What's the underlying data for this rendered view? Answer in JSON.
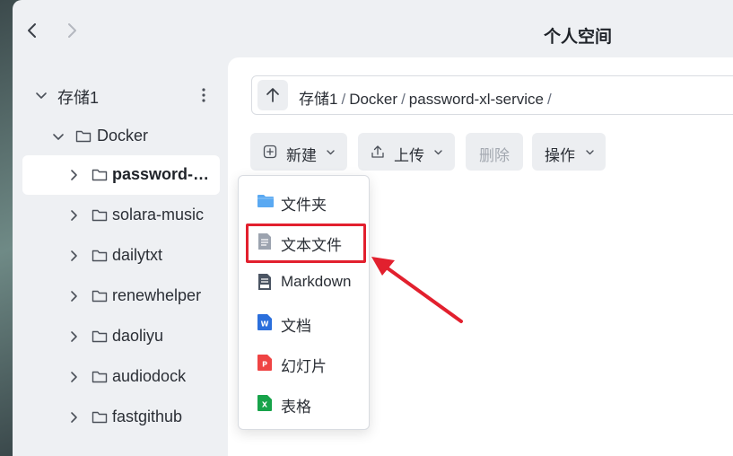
{
  "window": {
    "title": "个人空间"
  },
  "sidebar": {
    "root": {
      "label": "存储1"
    },
    "folder": {
      "label": "Docker"
    },
    "items": [
      {
        "label": "password-…",
        "selected": true
      },
      {
        "label": "solara-music"
      },
      {
        "label": "dailytxt"
      },
      {
        "label": "renewhelper"
      },
      {
        "label": "daoliyu"
      },
      {
        "label": "audiodock"
      },
      {
        "label": "fastgithub"
      }
    ]
  },
  "breadcrumb": {
    "parts": [
      "存储1",
      "Docker",
      "password-xl-service"
    ],
    "separator": "/"
  },
  "toolbar": {
    "new_label": "新建",
    "upload_label": "上传",
    "delete_label": "删除",
    "actions_label": "操作"
  },
  "new_menu": {
    "items": [
      {
        "label": "文件夹",
        "icon": "folder-icon"
      },
      {
        "label": "文本文件",
        "icon": "text-file-icon",
        "highlighted": true
      },
      {
        "label": "Markdown",
        "icon": "markdown-icon"
      },
      {
        "label": "文档",
        "icon": "word-doc-icon",
        "badge": "W"
      },
      {
        "label": "幻灯片",
        "icon": "slides-icon",
        "badge": "P"
      },
      {
        "label": "表格",
        "icon": "spreadsheet-icon",
        "badge": "X"
      }
    ]
  },
  "colors": {
    "accent_highlight": "#e2202e",
    "folder_blue": "#5aa9f2",
    "word_blue": "#2b6fdc",
    "ppt_red": "#ef4444",
    "excel_green": "#17a34a"
  }
}
